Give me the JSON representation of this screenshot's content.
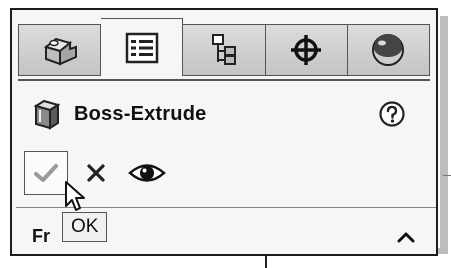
{
  "tabs": [
    {
      "name": "featuremanager",
      "icon": "part-cube-icon",
      "active": false
    },
    {
      "name": "propertymanager",
      "icon": "property-list-icon",
      "active": true
    },
    {
      "name": "configurationmanager",
      "icon": "configuration-tree-icon",
      "active": false
    },
    {
      "name": "dimxpertmanager",
      "icon": "crosshair-icon",
      "active": false
    },
    {
      "name": "displaymanager",
      "icon": "appearance-sphere-icon",
      "active": false
    }
  ],
  "feature": {
    "title": "Boss-Extrude",
    "icon": "extrude-feature-icon"
  },
  "help": {
    "icon": "help-circle-icon"
  },
  "actions": {
    "ok_icon": "checkmark-icon",
    "cancel_icon": "close-icon",
    "preview_icon": "eye-icon"
  },
  "section": {
    "title": "Fr",
    "icon": "chevron-up-icon"
  },
  "tooltip": {
    "text": "OK"
  },
  "colors": {
    "panel_bg": "#f6f6f6",
    "tab_bg": "#c8c8c8",
    "border": "#1c1c1c",
    "ok_check": "#9a9a9a"
  }
}
